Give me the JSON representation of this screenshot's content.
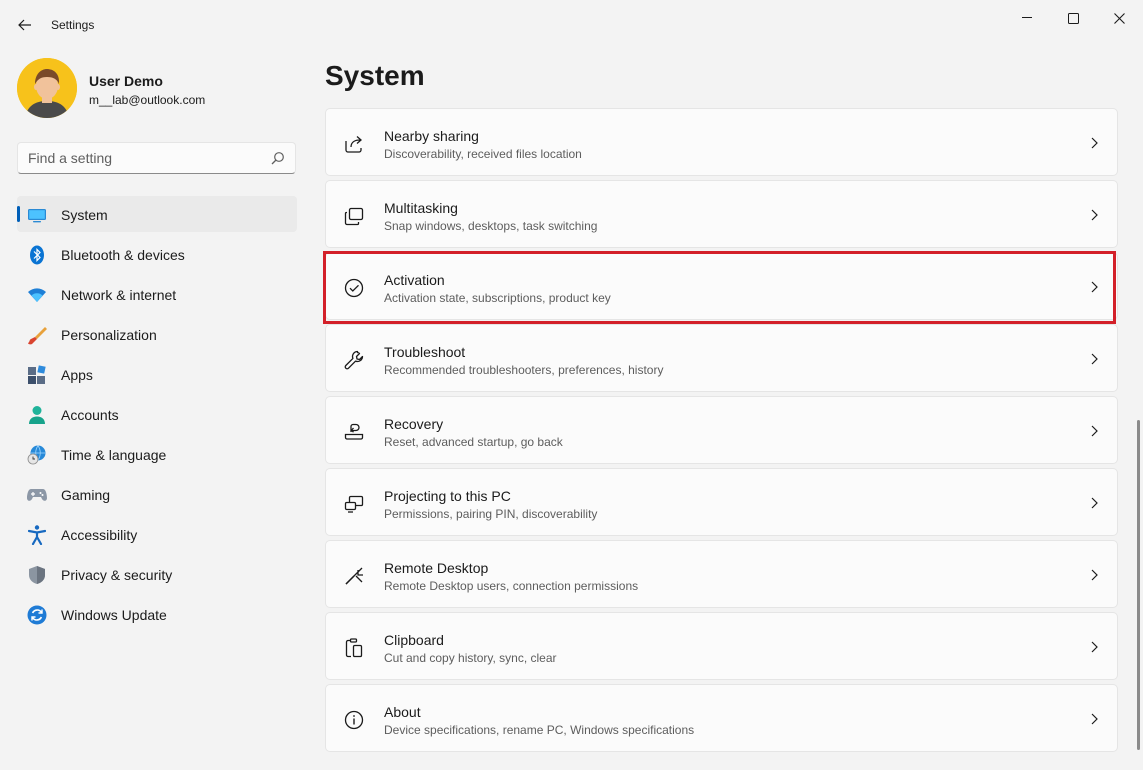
{
  "window": {
    "title": "Settings",
    "accent_color": "#005fb8",
    "highlight_color": "#d32029"
  },
  "profile": {
    "name": "User Demo",
    "email": "m__lab@outlook.com"
  },
  "search": {
    "placeholder": "Find a setting",
    "value": ""
  },
  "nav": {
    "selected": "System",
    "items": [
      {
        "label": "System",
        "icon": "monitor-icon"
      },
      {
        "label": "Bluetooth & devices",
        "icon": "bluetooth-icon"
      },
      {
        "label": "Network & internet",
        "icon": "wifi-icon"
      },
      {
        "label": "Personalization",
        "icon": "brush-icon"
      },
      {
        "label": "Apps",
        "icon": "apps-icon"
      },
      {
        "label": "Accounts",
        "icon": "person-icon"
      },
      {
        "label": "Time & language",
        "icon": "globe-clock-icon"
      },
      {
        "label": "Gaming",
        "icon": "gamepad-icon"
      },
      {
        "label": "Accessibility",
        "icon": "accessibility-icon"
      },
      {
        "label": "Privacy & security",
        "icon": "shield-icon"
      },
      {
        "label": "Windows Update",
        "icon": "update-icon"
      }
    ]
  },
  "main": {
    "title": "System",
    "highlighted_item": "Activation",
    "cards": [
      {
        "title": "Nearby sharing",
        "desc": "Discoverability, received files location",
        "icon": "share-icon"
      },
      {
        "title": "Multitasking",
        "desc": "Snap windows, desktops, task switching",
        "icon": "multitasking-icon"
      },
      {
        "title": "Activation",
        "desc": "Activation state, subscriptions, product key",
        "icon": "checkmark-circle-icon"
      },
      {
        "title": "Troubleshoot",
        "desc": "Recommended troubleshooters, preferences, history",
        "icon": "wrench-icon"
      },
      {
        "title": "Recovery",
        "desc": "Reset, advanced startup, go back",
        "icon": "recovery-icon"
      },
      {
        "title": "Projecting to this PC",
        "desc": "Permissions, pairing PIN, discoverability",
        "icon": "projecting-icon"
      },
      {
        "title": "Remote Desktop",
        "desc": "Remote Desktop users, connection permissions",
        "icon": "remote-desktop-icon"
      },
      {
        "title": "Clipboard",
        "desc": "Cut and copy history, sync, clear",
        "icon": "clipboard-icon"
      },
      {
        "title": "About",
        "desc": "Device specifications, rename PC, Windows specifications",
        "icon": "info-icon"
      }
    ]
  }
}
